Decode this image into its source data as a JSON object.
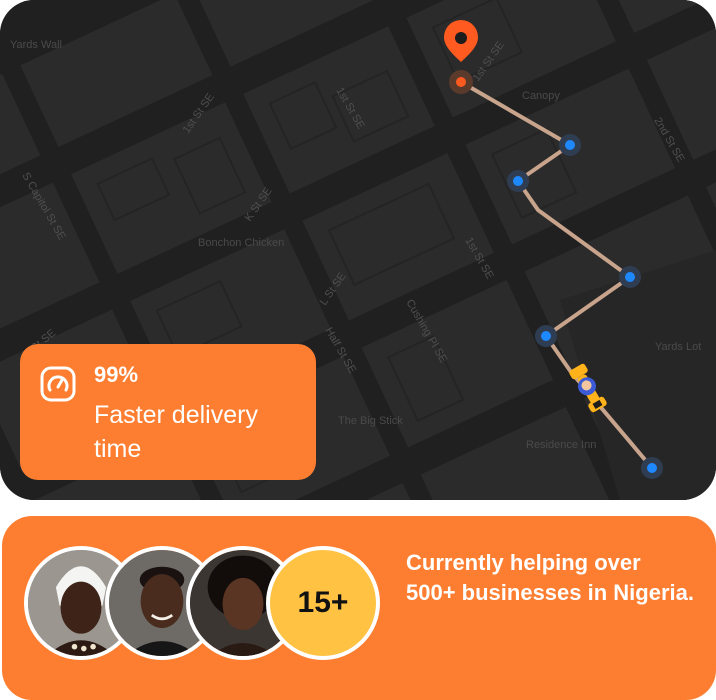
{
  "map": {
    "street_labels": [
      "1st St SE",
      "1st St SE",
      "1st St SE",
      "2nd St SE",
      "S Capitol St SE",
      "K St SE",
      "L St SE",
      "Half St SE",
      "Cushing Pl SE",
      "I St SE",
      "1st St SE"
    ],
    "poi_labels": [
      "Bonchon Chicken",
      "The Big Stick",
      "Residence Inn",
      "Canopy",
      "Yards Wall",
      "Yards Lot"
    ]
  },
  "stat": {
    "value": "99%",
    "label": "Faster delivery time",
    "icon": "speedometer-icon"
  },
  "banner": {
    "count": "15+",
    "text": "Currently helping over 500+ businesses in Nigeria."
  },
  "colors": {
    "brand_orange": "#fd7e30",
    "count_yellow": "#ffc243",
    "route": "#c9a48c",
    "waypoint": "#1e88ff",
    "pin": "#ff5a1f"
  }
}
